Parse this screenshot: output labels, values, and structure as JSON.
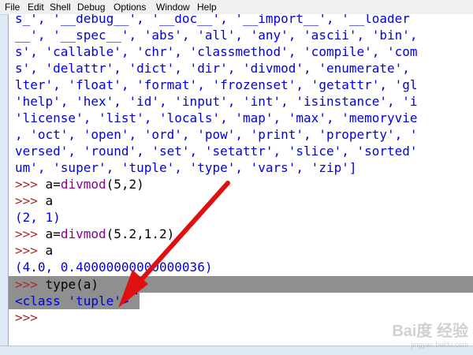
{
  "menubar": {
    "items": [
      "File",
      "Edit",
      "Shell",
      "Debug",
      "Options",
      "Window",
      "Help"
    ]
  },
  "shell": {
    "dir_output_lines": [
      "s_', '__debug__', '__doc__', '__import__', '__loader",
      "__', '__spec__', 'abs', 'all', 'any', 'ascii', 'bin',",
      "s', 'callable', 'chr', 'classmethod', 'compile', 'com",
      "s', 'delattr', 'dict', 'dir', 'divmod', 'enumerate',",
      "lter', 'float', 'format', 'frozenset', 'getattr', 'gl",
      "'help', 'hex', 'id', 'input', 'int', 'isinstance', 'i",
      "'license', 'list', 'locals', 'map', 'max', 'memoryvie",
      ", 'oct', 'open', 'ord', 'pow', 'print', 'property', '",
      "versed', 'round', 'set', 'setattr', 'slice', 'sorted'",
      "um', 'super', 'tuple', 'type', 'vars', 'zip']"
    ],
    "prompt": ">>>",
    "cmd1_var": "a=",
    "cmd1_func": "divmod",
    "cmd1_args": "(5,2)",
    "cmd2": "a",
    "out1": "(2, 1)",
    "cmd3_var": "a=",
    "cmd3_func": "divmod",
    "cmd3_args": "(5.2,1.2)",
    "cmd4": "a",
    "out2": "(4.0, 0.40000000000000036)",
    "cmd5": "type(a)",
    "out3": "<class 'tuple'>"
  },
  "watermark": {
    "text": "Bai度 经验",
    "sub": "jingyan.baidu.com"
  },
  "colors": {
    "output_blue": "#0000e0",
    "prompt_brown": "#a52a2a",
    "builtin_purple": "#8b008b",
    "selection_gray": "#8f8f8f",
    "arrow_red": "#e01010"
  }
}
